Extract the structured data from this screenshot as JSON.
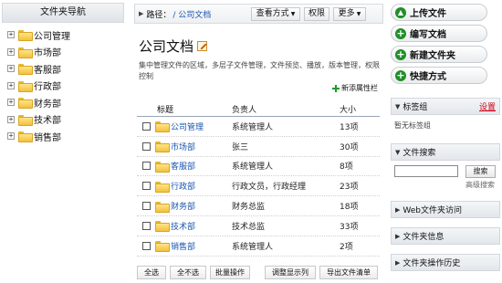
{
  "nav": {
    "title": "文件夹导航",
    "items": [
      "公司管理",
      "市场部",
      "客服部",
      "行政部",
      "财务部",
      "技术部",
      "销售部"
    ]
  },
  "pathbar": {
    "label": "路径：",
    "current": "/ 公司文档",
    "view_mode": "查看方式",
    "permissions": "权限",
    "more": "更多"
  },
  "page": {
    "title": "公司文档",
    "description": "集中管理文件的区域，多层子文件管理，文件预览、播放，版本管理，权限控制",
    "add_custom_column": "新添属性栏"
  },
  "table": {
    "headers": {
      "title": "标题",
      "owner": "负责人",
      "size": "大小"
    },
    "rows": [
      {
        "name": "公司管理",
        "owner": "系统管理人",
        "size": "13项"
      },
      {
        "name": "市场部",
        "owner": "张三",
        "size": "30项"
      },
      {
        "name": "客服部",
        "owner": "系统管理人",
        "size": "8项"
      },
      {
        "name": "行政部",
        "owner": "行政文员，行政经理",
        "size": "23项"
      },
      {
        "name": "财务部",
        "owner": "财务总监",
        "size": "18项"
      },
      {
        "name": "技术部",
        "owner": "技术总监",
        "size": "33项"
      },
      {
        "name": "销售部",
        "owner": "系统管理人",
        "size": "2项"
      }
    ]
  },
  "bottom": {
    "select_all": "全选",
    "select_none": "全不选",
    "batch": "批量操作",
    "adjust_columns": "调整显示列",
    "export_list": "导出文件清单"
  },
  "actions": {
    "upload": "上传文件",
    "write": "编写文档",
    "new_folder": "新建文件夹",
    "quick": "快捷方式"
  },
  "panels": {
    "tags": "标签组",
    "tags_set": "设置",
    "no_tags": "暂无标签组",
    "search": "文件搜索",
    "search_btn": "搜索",
    "advanced": "高级搜索",
    "web_access": "Web文件夹访问",
    "folder_info": "文件夹信息",
    "folder_history": "文件夹操作历史"
  },
  "colors": {
    "link": "#1a56b0",
    "accent_green": "#1f8f27",
    "set_link": "#d0021b"
  }
}
